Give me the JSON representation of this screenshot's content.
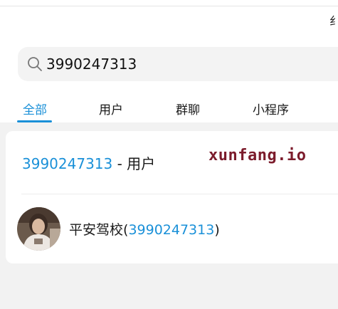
{
  "window": {
    "corner_char": "纟"
  },
  "search": {
    "value": "3990247313",
    "icon": "search-icon"
  },
  "tabs": [
    {
      "label": "全部",
      "active": true
    },
    {
      "label": "用户",
      "active": false
    },
    {
      "label": "群聊",
      "active": false
    },
    {
      "label": "小程序",
      "active": false
    }
  ],
  "results": {
    "user": {
      "number": "3990247313",
      "suffix": " - 用户"
    },
    "contact": {
      "name": "平安驾校",
      "open_paren": "(",
      "number": "3990247313",
      "close_paren": ")"
    }
  },
  "watermark": "xunfang.io",
  "colors": {
    "accent": "#1a90d8",
    "watermark": "#7c1c2c",
    "background": "#f2f2f2"
  }
}
